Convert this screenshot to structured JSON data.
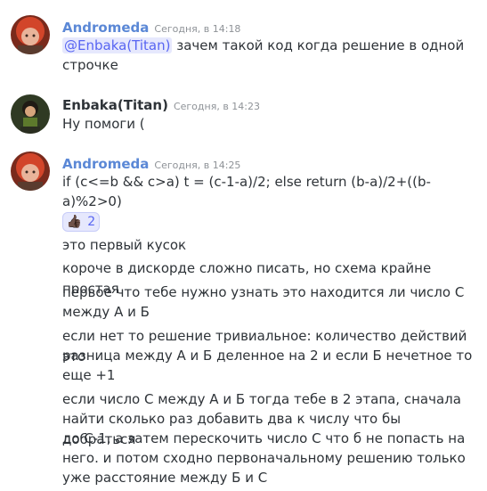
{
  "messages": [
    {
      "username": "Andromeda",
      "username_color": "#5b88d6",
      "timestamp": "Сегодня, в 14:18",
      "mention": "@Enbaka(Titan)",
      "line1_rest": " зачем такой код когда решение в одной",
      "line2": "строчке"
    },
    {
      "username": "Enbaka(Titan)",
      "username_color": "#2e3338",
      "timestamp": "Сегодня, в 14:23",
      "line1": "Ну помоги ("
    },
    {
      "username": "Andromeda",
      "username_color": "#5b88d6",
      "timestamp": "Сегодня, в 14:25",
      "code_line1": "if (c<=b && c>a) t = (c-1-a)/2; else return (b-a)/2+((b-",
      "code_line2": "a)%2>0)",
      "reaction": {
        "emoji": "👍🏿",
        "icon": "thumbs-up-icon",
        "count": "2"
      },
      "p1": "это первый кусок",
      "p2": "короче в дискорде сложно писать, но схема крайне простая",
      "p3_l1": "первое что тебе нужно узнать это находится ли число С",
      "p3_l2": "между А и Б",
      "p4_l1": "если нет то решение тривиальное: количество действий это",
      "p4_l2": "разница между А и Б деленное на 2 и если Б нечетное то",
      "p4_l3": "еще +1",
      "p5_l1": "если число С между А и Б тогда тебе в 2 этапа, сначала",
      "p5_l2": "найти сколько раз добавить два к числу что бы добраться",
      "p5_l3": "до С-1, а затем перескочить число С что б не попасть на",
      "p5_l4": "него. и потом сходно первоначальному решению только",
      "p5_l5": "уже расстояние между Б и С"
    }
  ]
}
